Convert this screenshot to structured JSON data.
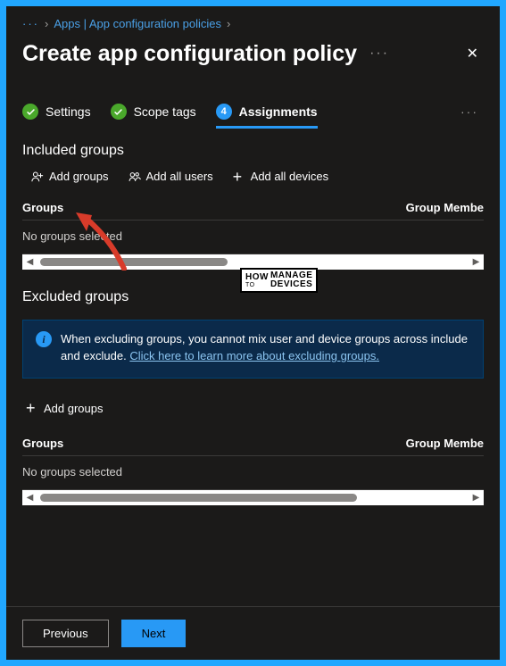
{
  "breadcrumb": {
    "link": "Apps | App configuration policies"
  },
  "title": "Create app configuration policy",
  "tabs": {
    "settings": "Settings",
    "scope": "Scope tags",
    "assignments": "Assignments",
    "current_number": "4"
  },
  "included": {
    "heading": "Included groups",
    "add_groups": "Add groups",
    "add_all_users": "Add all users",
    "add_all_devices": "Add all devices",
    "col_groups": "Groups",
    "col_members": "Group Membe",
    "empty": "No groups selected"
  },
  "excluded": {
    "heading": "Excluded groups",
    "info_text": "When excluding groups, you cannot mix user and device groups across include and exclude. ",
    "info_link": "Click here to learn more about excluding groups.",
    "add_groups": "Add groups",
    "col_groups": "Groups",
    "col_members": "Group Membe",
    "empty": "No groups selected"
  },
  "footer": {
    "previous": "Previous",
    "next": "Next"
  },
  "watermark": {
    "how": "HOW",
    "to": "TO",
    "manage": "MANAGE",
    "devices": "DEVICES"
  }
}
